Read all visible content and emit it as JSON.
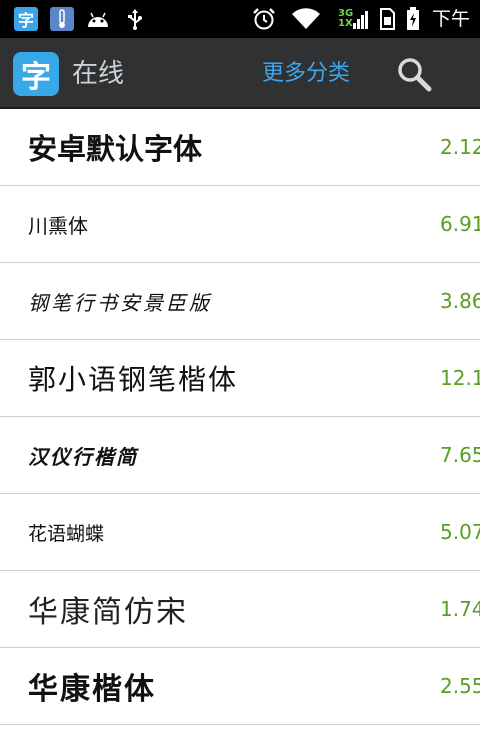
{
  "status_bar": {
    "app_icon_text": "字",
    "network_type": "3G",
    "network_type_sub": "1X",
    "time": "下午"
  },
  "action_bar": {
    "logo_text": "字",
    "title": "在线",
    "more_categories": "更多分类"
  },
  "fonts": [
    {
      "name": "安卓默认字体",
      "size": "2.12"
    },
    {
      "name": "川熏体",
      "size": "6.91"
    },
    {
      "name": "钢笔行书安景臣版",
      "size": "3.86"
    },
    {
      "name": "郭小语钢笔楷体",
      "size": "12.1"
    },
    {
      "name": "汉仪行楷简",
      "size": "7.65"
    },
    {
      "name": "花语蝴蝶",
      "size": "5.07"
    },
    {
      "name": "华康简仿宋",
      "size": "1.74"
    },
    {
      "name": "华康楷体",
      "size": "2.55"
    }
  ],
  "colors": {
    "status_bar_bg": "#000000",
    "action_bar_bg": "#2f3133",
    "accent_blue": "#3ba5ef",
    "size_green": "#5a9e23"
  }
}
